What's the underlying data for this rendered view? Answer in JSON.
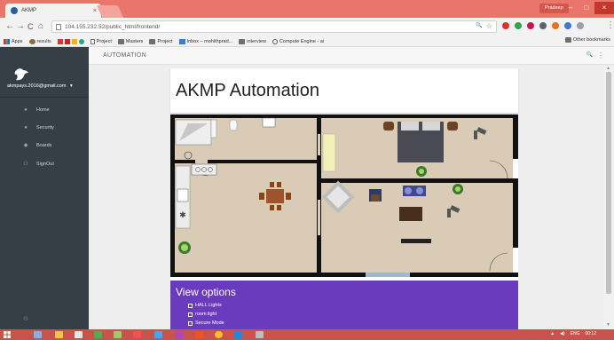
{
  "browser": {
    "tab_title": "AKMP",
    "tab_close": "×",
    "profile": "Pradeep",
    "win_min": "–",
    "win_max": "□",
    "win_close": "×",
    "url": "104.155.232.52/public_html/frontend/",
    "nav": {
      "back": "←",
      "forward": "→",
      "reload": "C",
      "home": "⌂"
    },
    "omnibox_icons": {
      "search": "🔍",
      "star": "☆"
    },
    "menu": "⋮",
    "bookmarks": [
      {
        "label": "Apps",
        "icon": "apps-icon"
      },
      {
        "label": "results",
        "icon": "results-icon"
      },
      {
        "label": "Project",
        "icon": "page-icon"
      },
      {
        "label": "Masters",
        "icon": "folder-icon"
      },
      {
        "label": "Project",
        "icon": "folder-icon"
      },
      {
        "label": "Inbox – mohithprad...",
        "icon": "mail-icon"
      },
      {
        "label": "interview",
        "icon": "folder-icon"
      },
      {
        "label": "Compute Engine - ai",
        "icon": "cloud-icon"
      }
    ],
    "other_bookmarks": "Other bookmarks"
  },
  "sidebar": {
    "user_email": "akmpays.2016@gmail.com",
    "user_caret": "▾",
    "items": [
      {
        "label": "Home",
        "icon": "home-icon",
        "glyph": "♠"
      },
      {
        "label": "Security",
        "icon": "security-icon",
        "glyph": "●"
      },
      {
        "label": "Boards",
        "icon": "boards-icon",
        "glyph": "◆"
      },
      {
        "label": "SignOut",
        "icon": "signout-icon",
        "glyph": "⚇"
      }
    ],
    "footer_icon": "⊙"
  },
  "header": {
    "title": "AUTOMATION",
    "search_icon": "🔍",
    "more_icon": "⋮"
  },
  "main": {
    "page_title": "AKMP Automation",
    "view_options_title": "View options",
    "options": [
      {
        "label": "HALL Lights"
      },
      {
        "label": "room light"
      },
      {
        "label": "Secure Mode"
      }
    ]
  },
  "taskbar": {
    "tray_lang": "ENG",
    "clock": "00:12"
  },
  "colors": {
    "tab_bar": "#e9756b",
    "sidebar": "#363f45",
    "options_panel": "#6a3bbd",
    "floor": "#d9cbb6"
  }
}
